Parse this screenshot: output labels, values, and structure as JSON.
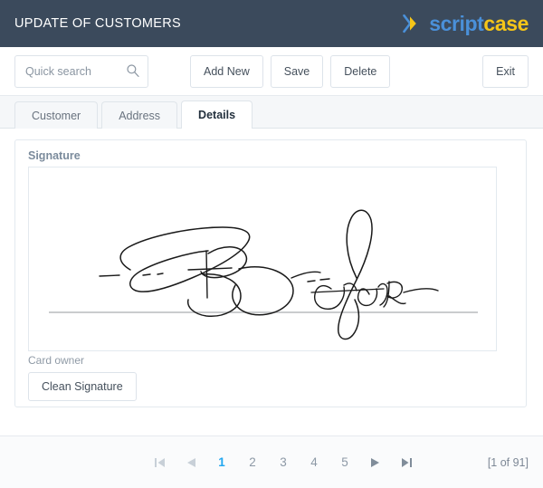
{
  "header": {
    "title": "UPDATE OF CUSTOMERS",
    "logo": {
      "icon": "scriptcase-chevron-icon",
      "text_primary": "script",
      "text_secondary": "case",
      "color_primary": "#4a90d9",
      "color_secondary": "#f5c518"
    },
    "background_color": "#3b4a5c"
  },
  "toolbar": {
    "search": {
      "placeholder": "Quick search",
      "value": "",
      "icon": "search-icon"
    },
    "buttons": [
      {
        "label": "Add New",
        "name": "add-new-button"
      },
      {
        "label": "Save",
        "name": "save-button"
      },
      {
        "label": "Delete",
        "name": "delete-button"
      }
    ],
    "exit": {
      "label": "Exit",
      "name": "exit-button"
    }
  },
  "tabs": [
    {
      "label": "Customer",
      "active": false
    },
    {
      "label": "Address",
      "active": false
    },
    {
      "label": "Details",
      "active": true
    }
  ],
  "main": {
    "fieldset_legend": "Signature",
    "signature": {
      "field_label": "Card owner",
      "has_drawing": true,
      "baseline_visible": true
    },
    "clean_button_label": "Clean Signature"
  },
  "footer": {
    "pagination": {
      "first_icon": "first-page-icon",
      "prev_icon": "previous-page-icon",
      "next_icon": "next-page-icon",
      "last_icon": "last-page-icon",
      "first_enabled": false,
      "prev_enabled": false,
      "next_enabled": true,
      "last_enabled": true,
      "pages": [
        "1",
        "2",
        "3",
        "4",
        "5"
      ],
      "current_page": "1",
      "active_color": "#22a7f0"
    },
    "record_counter": "[1 of 91]"
  }
}
